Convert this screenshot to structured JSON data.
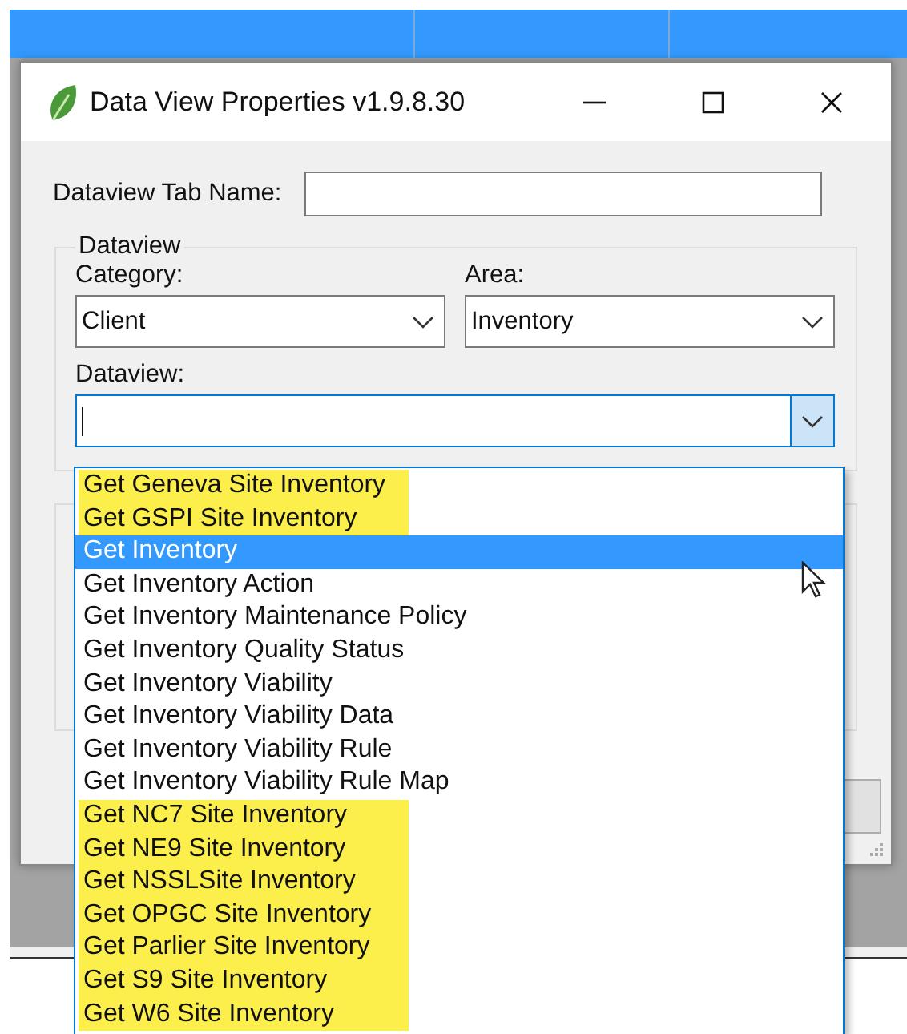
{
  "window": {
    "title": "Data View Properties v1.9.8.30"
  },
  "tab_name": {
    "label": "Dataview Tab Name:"
  },
  "group": {
    "title": "Dataview"
  },
  "category": {
    "label": "Category:",
    "value": "Client"
  },
  "area": {
    "label": "Area:",
    "value": "Inventory"
  },
  "dataview": {
    "label": "Dataview:",
    "open": true
  },
  "dropdown_items": [
    {
      "label": "Get Geneva Site Inventory",
      "selected": false,
      "highlighted": true
    },
    {
      "label": "Get GSPI Site Inventory",
      "selected": false,
      "highlighted": true
    },
    {
      "label": "Get Inventory",
      "selected": true,
      "highlighted": false
    },
    {
      "label": "Get Inventory Action",
      "selected": false,
      "highlighted": false
    },
    {
      "label": "Get Inventory Maintenance Policy",
      "selected": false,
      "highlighted": false
    },
    {
      "label": "Get Inventory Quality Status",
      "selected": false,
      "highlighted": false
    },
    {
      "label": "Get Inventory Viability",
      "selected": false,
      "highlighted": false
    },
    {
      "label": "Get Inventory Viability Data",
      "selected": false,
      "highlighted": false
    },
    {
      "label": "Get Inventory Viability Rule",
      "selected": false,
      "highlighted": false
    },
    {
      "label": "Get Inventory Viability Rule Map",
      "selected": false,
      "highlighted": false
    },
    {
      "label": "Get NC7 Site Inventory",
      "selected": false,
      "highlighted": true
    },
    {
      "label": "Get NE9 Site Inventory",
      "selected": false,
      "highlighted": true
    },
    {
      "label": "Get NSSLSite Inventory",
      "selected": false,
      "highlighted": true
    },
    {
      "label": "Get OPGC Site Inventory",
      "selected": false,
      "highlighted": true
    },
    {
      "label": "Get Parlier Site Inventory",
      "selected": false,
      "highlighted": true
    },
    {
      "label": "Get S9 Site Inventory",
      "selected": false,
      "highlighted": true
    },
    {
      "label": "Get W6 Site Inventory",
      "selected": false,
      "highlighted": true
    }
  ]
}
